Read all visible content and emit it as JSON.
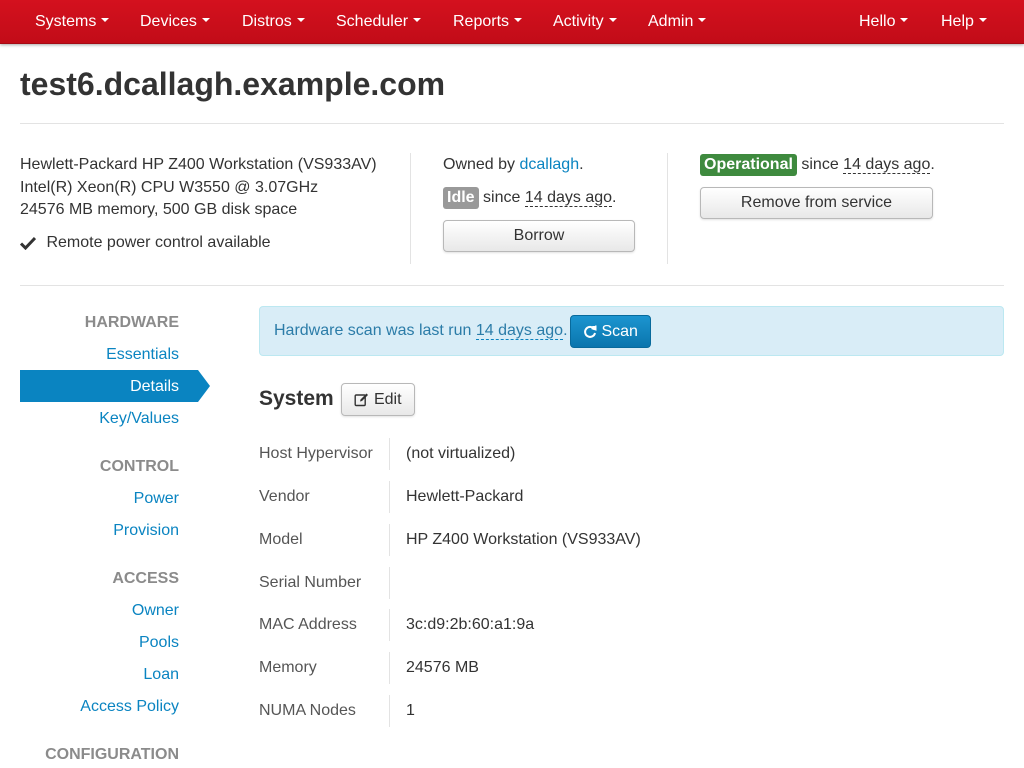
{
  "nav": {
    "left": [
      "Systems",
      "Devices",
      "Distros",
      "Scheduler",
      "Reports",
      "Activity",
      "Admin"
    ],
    "right": [
      "Hello",
      "Help"
    ]
  },
  "system": {
    "fqdn": "test6.dcallagh.example.com",
    "summary": {
      "model": "Hewlett-Packard HP Z400 Workstation (VS933AV)",
      "cpu": "Intel(R) Xeon(R) CPU W3550 @ 3.07GHz",
      "memory_disk": "24576 MB memory, 500 GB disk space",
      "power": "Remote power control available"
    },
    "owner": {
      "prefix": "Owned by",
      "name": "dcallagh",
      "suffix": "."
    },
    "usage": {
      "status": "Idle",
      "since": "since",
      "ago": "14 days ago",
      "suffix": ".",
      "button": "Borrow"
    },
    "condition": {
      "status": "Operational",
      "since": "since",
      "ago": "14 days ago",
      "suffix": ".",
      "button": "Remove from service"
    }
  },
  "sidebar": {
    "sections": [
      {
        "heading": "HARDWARE",
        "links": [
          "Essentials",
          "Details",
          "Key/Values"
        ]
      },
      {
        "heading": "CONTROL",
        "links": [
          "Power",
          "Provision"
        ]
      },
      {
        "heading": "ACCESS",
        "links": [
          "Owner",
          "Pools",
          "Loan",
          "Access Policy"
        ]
      },
      {
        "heading": "CONFIGURATION",
        "links": []
      }
    ],
    "active": "Details"
  },
  "alert": {
    "text": "Hardware scan was last run",
    "ago": "14 days ago",
    "suffix": ".",
    "scan_button": "Scan"
  },
  "details": {
    "heading": "System",
    "edit_button": "Edit",
    "rows": [
      {
        "label": "Host Hypervisor",
        "value": "(not virtualized)"
      },
      {
        "label": "Vendor",
        "value": "Hewlett-Packard"
      },
      {
        "label": "Model",
        "value": "HP Z400 Workstation (VS933AV)"
      },
      {
        "label": "Serial Number",
        "value": ""
      },
      {
        "label": "MAC Address",
        "value": "3c:d9:2b:60:a1:9a"
      },
      {
        "label": "Memory",
        "value": "24576 MB"
      },
      {
        "label": "NUMA Nodes",
        "value": "1"
      }
    ]
  },
  "colors": {
    "navbar": "#c9101b",
    "link": "#0a84c1",
    "operational": "#3e8a3e",
    "idle": "#999999",
    "alert_bg": "#d9edf7"
  }
}
